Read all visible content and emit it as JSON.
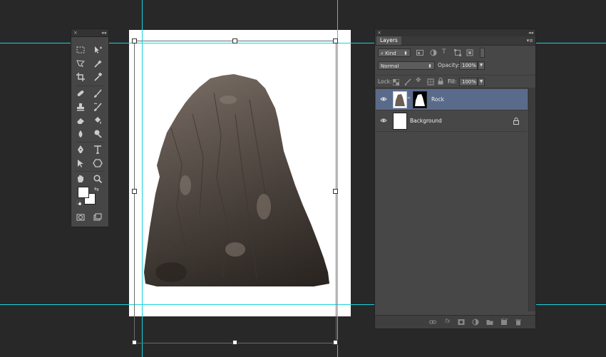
{
  "tools_panel": {
    "close_label": "×",
    "collapse_label": "◂◂",
    "tools": [
      "rect-marquee-icon",
      "move-icon",
      "lasso-icon",
      "magic-wand-icon",
      "crop-icon",
      "eyedropper-icon",
      "healing-brush-icon",
      "brush-icon",
      "clone-stamp-icon",
      "history-brush-icon",
      "eraser-icon",
      "paint-bucket-icon",
      "blur-icon",
      "dodge-icon",
      "pen-icon",
      "type-icon",
      "path-select-icon",
      "shape-icon",
      "hand-icon",
      "zoom-icon",
      "quick-mask-icon",
      "screen-mode-icon"
    ],
    "foreground_color": "#ffffff",
    "background_color": "#ffffff"
  },
  "layers_panel": {
    "close_label": "×",
    "collapse_label": "◂◂",
    "tab_label": "Layers",
    "menu_label": "▾≡",
    "filter": {
      "kind_label": "Kind"
    },
    "blend_mode": "Normal",
    "opacity_label": "Opacity:",
    "opacity_value": "100%",
    "lock_label": "Lock:",
    "fill_label": "Fill:",
    "fill_value": "100%",
    "layers": [
      {
        "name": "Rock",
        "selected": true,
        "has_mask": true,
        "locked": false
      },
      {
        "name": "Background",
        "selected": false,
        "has_mask": false,
        "locked": true
      }
    ]
  },
  "colors": {
    "canvas_bg": "#282828",
    "guide": "#19d3de",
    "selected_layer": "#5a6a8a"
  }
}
